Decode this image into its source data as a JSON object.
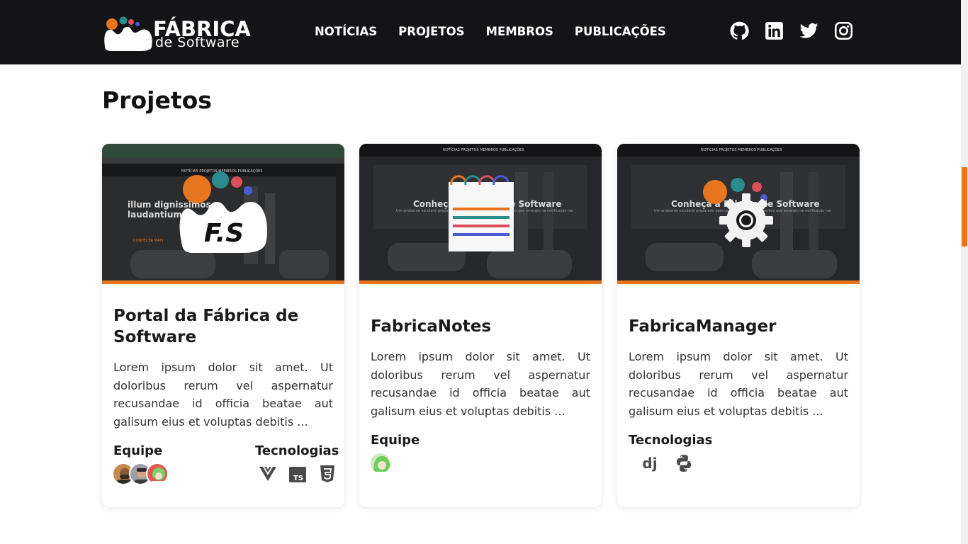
{
  "brand": {
    "title": "FÁBRICA",
    "subtitle": "de Software",
    "accent": "#e8761e",
    "dot_colors": [
      "#e8761e",
      "#2a8c8c",
      "#d94f5c",
      "#4a5bd4"
    ]
  },
  "nav": {
    "items": [
      {
        "label": "NOTÍCIAS"
      },
      {
        "label": "PROJETOS"
      },
      {
        "label": "MEMBROS"
      },
      {
        "label": "PUBLICAÇÕES"
      }
    ]
  },
  "social": [
    "github-icon",
    "linkedin-icon",
    "twitter-icon",
    "instagram-icon"
  ],
  "page": {
    "title": "Projetos"
  },
  "projects": [
    {
      "title": "Portal da Fábrica de Software",
      "description": "Lorem ipsum dolor sit amet. Ut doloribus rerum vel aspernatur recusandae id officia beatae aut galisum eius et voluptas debitis ...",
      "team_label": "Equipe",
      "tech_label": "Tecnologias",
      "techs": [
        "vue-icon",
        "typescript-icon",
        "css3-icon"
      ],
      "preview": {
        "hero_title": "illum dignissimos laudantium",
        "nav": "NOTÍCIAS   PROJETOS   MEMBROS   PUBLICAÇÕES",
        "button": "CONHECER MAIS"
      }
    },
    {
      "title": "FabricaNotes",
      "description": "Lorem ipsum dolor sit amet. Ut doloribus rerum vel aspernatur recusandae id officia beatae aut galisum eius et voluptas debitis ...",
      "team_label": "Equipe",
      "preview": {
        "hero_title": "Conheça a Fábrica de Software",
        "nav": "NOTÍCIAS   PROJETOS   MEMBROS   PUBLICAÇÕES",
        "sub": "Um ambiente escolarsi preparado para cada um fazer o seu Tecnico que emergiu na notificação nas práticas da uma verdadeira se..."
      }
    },
    {
      "title": "FabricaManager",
      "description": "Lorem ipsum dolor sit amet. Ut doloribus rerum vel aspernatur recusandae id officia beatae aut galisum eius et voluptas debitis ...",
      "tech_label": "Tecnologias",
      "techs": [
        "django-icon",
        "python-icon"
      ],
      "preview": {
        "hero_title": "Conheça a Fábrica de Software",
        "nav": "NOTÍCIAS   PROJETOS   MEMBROS   PUBLICAÇÕES",
        "sub": "Um ambiente escolarsi preparado para cada um fazer o seu Tecnico que emergiu na notificação nas práticas da uma verdadeira se..."
      }
    }
  ]
}
